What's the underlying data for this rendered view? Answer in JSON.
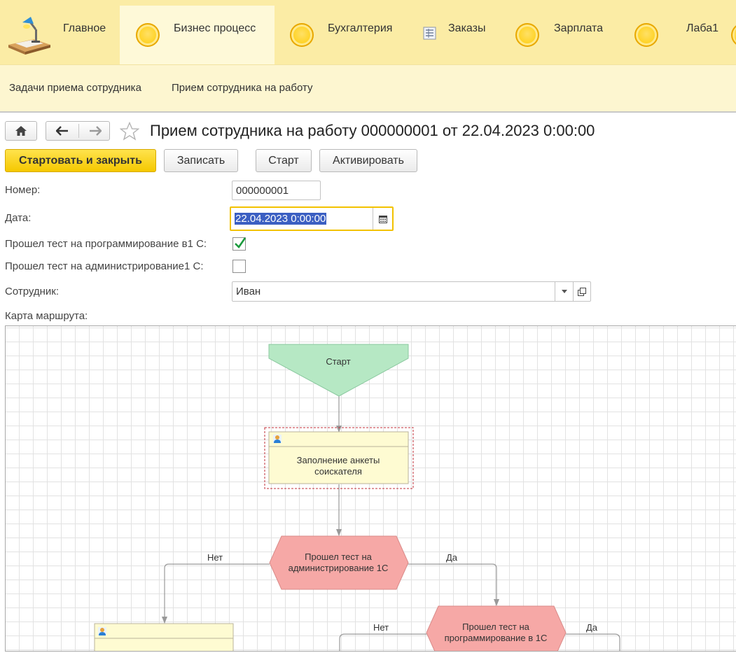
{
  "sections": {
    "main": "Главное",
    "business": "Бизнес процесс",
    "accounting": "Бухгалтерия",
    "orders": "Заказы",
    "salary": "Зарплата",
    "lab": "Лаба1"
  },
  "subsections": {
    "tasks": "Задачи приема сотрудника",
    "hiring": "Прием сотрудника на работу"
  },
  "document": {
    "title": "Прием сотрудника на работу 000000001 от 22.04.2023 0:00:00"
  },
  "commands": {
    "start_close": "Стартовать и закрыть",
    "write": "Записать",
    "start": "Старт",
    "activate": "Активировать"
  },
  "form": {
    "number_label": "Номер:",
    "number_value": "000000001",
    "date_label": "Дата:",
    "date_value": "22.04.2023  0:00:00",
    "prog_test_label": "Прошел тест на программирование в1 С:",
    "prog_test_checked": true,
    "admin_test_label": "Прошел тест на администрирование1 С:",
    "admin_test_checked": false,
    "employee_label": "Сотрудник:",
    "employee_value": "Иван",
    "map_label": "Карта маршрута:"
  },
  "route_map": {
    "start": "Старт",
    "task1_line1": "Заполнение анкеты",
    "task1_line2": "соискателя",
    "cond1_line1": "Прошел тест на",
    "cond1_line2": "администрирование 1С",
    "cond2_line1": "Прошел тест на",
    "cond2_line2": "программирование в 1С",
    "no": "Нет",
    "yes": "Да"
  },
  "colors": {
    "section_bar": "#fbeca5",
    "primary_button": "#f5c800",
    "start_node": "#b6e8c4",
    "condition_node": "#f6a8a6",
    "task_node": "#fefbd2"
  }
}
